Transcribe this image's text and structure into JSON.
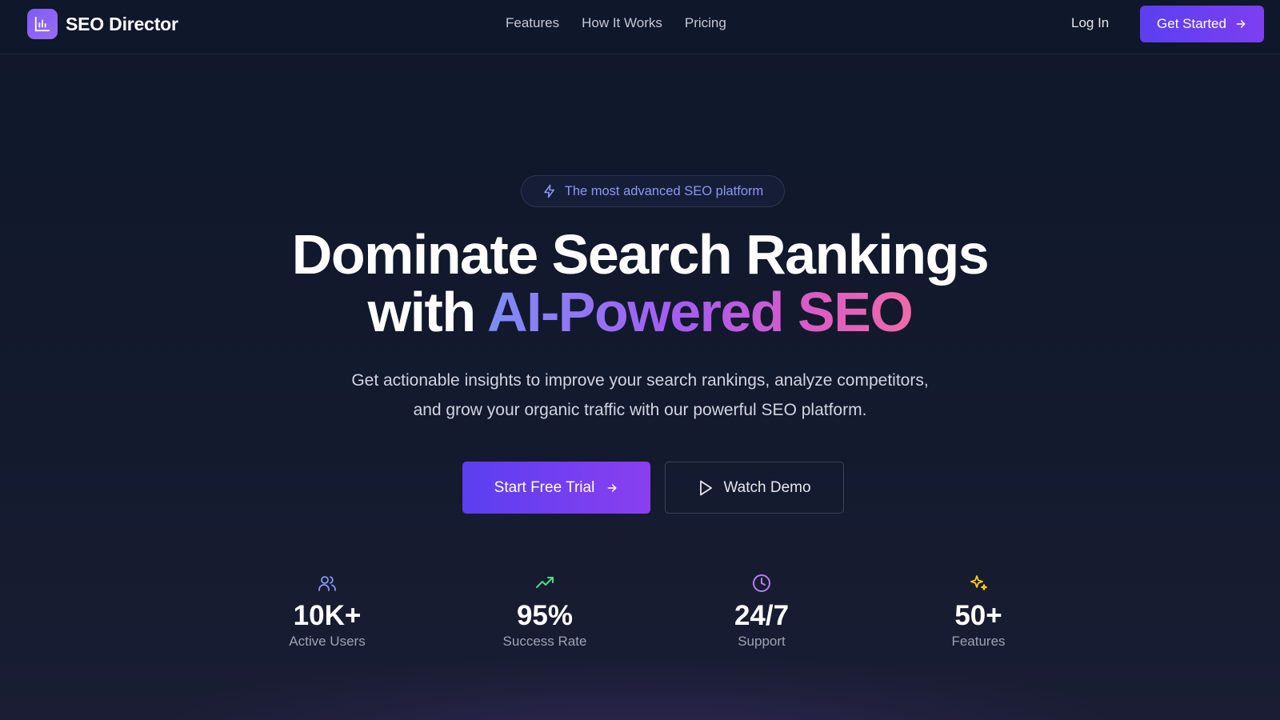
{
  "nav": {
    "brand": "SEO Director",
    "links": [
      "Features",
      "How It Works",
      "Pricing"
    ],
    "login": "Log In",
    "cta": "Get Started"
  },
  "hero": {
    "badge": "The most advanced SEO platform",
    "headline_line1": "Dominate Search Rankings",
    "headline_with": "with ",
    "headline_highlight": "AI-Powered SEO",
    "subtitle_line1": "Get actionable insights to improve your search rankings, analyze competitors,",
    "subtitle_line2": "and grow your organic traffic with our powerful SEO platform.",
    "primary_cta": "Start Free Trial",
    "secondary_cta": "Watch Demo"
  },
  "stats": [
    {
      "value": "10K+",
      "label": "Active Users",
      "icon": "users-icon"
    },
    {
      "value": "95%",
      "label": "Success Rate",
      "icon": "trending-up-icon"
    },
    {
      "value": "24/7",
      "label": "Support",
      "icon": "clock-icon"
    },
    {
      "value": "50+",
      "label": "Features",
      "icon": "sparkles-icon"
    }
  ],
  "colors": {
    "background": "#0f172a",
    "accent_start": "#5b3ff0",
    "accent_end": "#8a3ff0",
    "badge_text": "#8d97f2"
  }
}
